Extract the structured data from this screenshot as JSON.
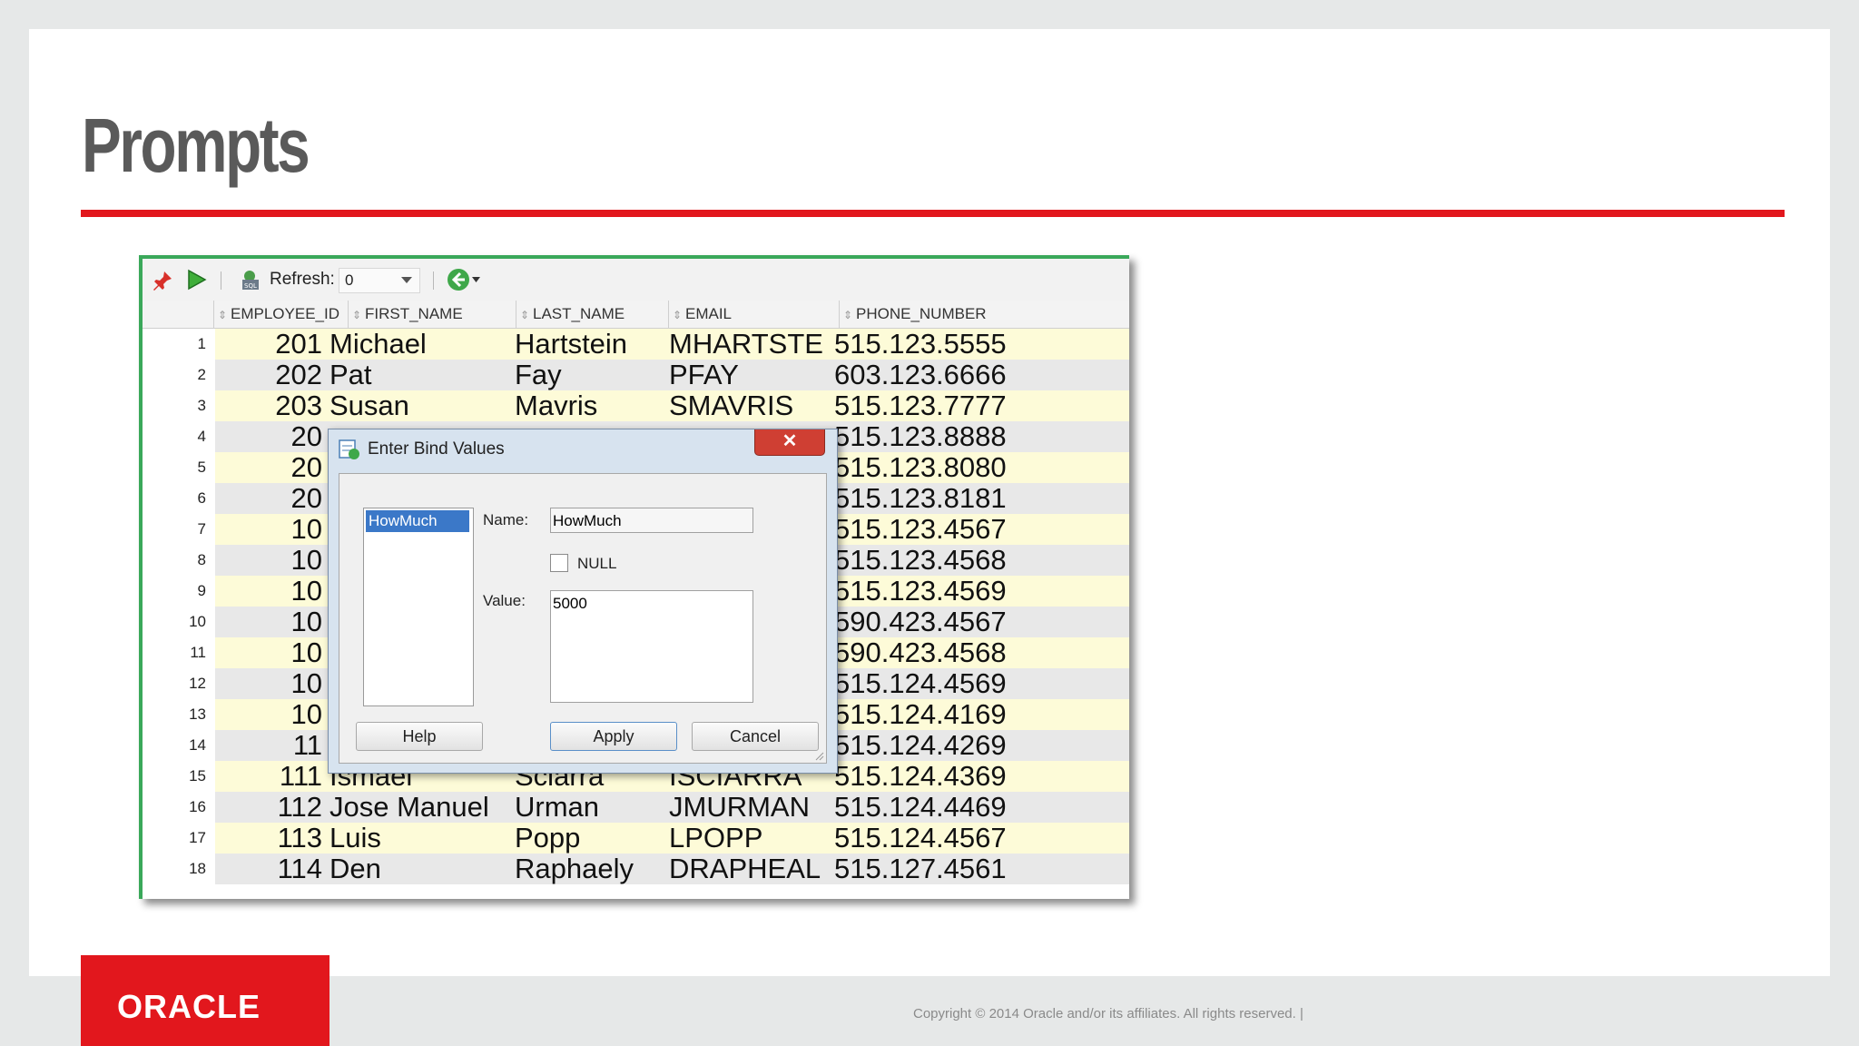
{
  "slide": {
    "title": "Prompts",
    "footer": "Copyright © 2014 Oracle and/or its affiliates. All rights reserved.  |",
    "logo": "ORACLE"
  },
  "toolbar": {
    "refresh_label": "Refresh:",
    "refresh_value": "0",
    "icons": [
      "pin-icon",
      "run-icon",
      "sql-icon",
      "back-icon"
    ]
  },
  "grid": {
    "columns": [
      "EMPLOYEE_ID",
      "FIRST_NAME",
      "LAST_NAME",
      "EMAIL",
      "PHONE_NUMBER"
    ],
    "rows": [
      {
        "n": "1",
        "id": "201",
        "first": "Michael",
        "last": "Hartstein",
        "email": "MHARTSTE",
        "phone": "515.123.5555"
      },
      {
        "n": "2",
        "id": "202",
        "first": "Pat",
        "last": "Fay",
        "email": "PFAY",
        "phone": "603.123.6666"
      },
      {
        "n": "3",
        "id": "203",
        "first": "Susan",
        "last": "Mavris",
        "email": "SMAVRIS",
        "phone": "515.123.7777"
      },
      {
        "n": "4",
        "id": "20",
        "first": "",
        "last": "",
        "email": "",
        "phone": "515.123.8888"
      },
      {
        "n": "5",
        "id": "20",
        "first": "",
        "last": "",
        "email": "",
        "phone": "515.123.8080"
      },
      {
        "n": "6",
        "id": "20",
        "first": "",
        "last": "",
        "email": "",
        "phone": "515.123.8181"
      },
      {
        "n": "7",
        "id": "10",
        "first": "",
        "last": "",
        "email": "",
        "phone": "515.123.4567"
      },
      {
        "n": "8",
        "id": "10",
        "first": "",
        "last": "",
        "email": "",
        "phone": "515.123.4568"
      },
      {
        "n": "9",
        "id": "10",
        "first": "",
        "last": "",
        "email": "",
        "phone": "515.123.4569"
      },
      {
        "n": "10",
        "id": "10",
        "first": "",
        "last": "",
        "email": "",
        "phone": "590.423.4567"
      },
      {
        "n": "11",
        "id": "10",
        "first": "",
        "last": "",
        "email": "",
        "phone": "590.423.4568"
      },
      {
        "n": "12",
        "id": "10",
        "first": "",
        "last": "",
        "email": "",
        "phone": "515.124.4569"
      },
      {
        "n": "13",
        "id": "10",
        "first": "",
        "last": "",
        "email": "",
        "phone": "515.124.4169"
      },
      {
        "n": "14",
        "id": "11",
        "first": "",
        "last": "",
        "email": "",
        "phone": "515.124.4269"
      },
      {
        "n": "15",
        "id": "111",
        "first": "Ismael",
        "last": "Sciarra",
        "email": "ISCIARRA",
        "phone": "515.124.4369"
      },
      {
        "n": "16",
        "id": "112",
        "first": "Jose Manuel",
        "last": "Urman",
        "email": "JMURMAN",
        "phone": "515.124.4469"
      },
      {
        "n": "17",
        "id": "113",
        "first": "Luis",
        "last": "Popp",
        "email": "LPOPP",
        "phone": "515.124.4567"
      },
      {
        "n": "18",
        "id": "114",
        "first": "Den",
        "last": "Raphaely",
        "email": "DRAPHEAL",
        "phone": "515.127.4561"
      }
    ]
  },
  "dialog": {
    "title": "Enter Bind Values",
    "close_glyph": "✕",
    "bind_item": "HowMuch",
    "name_label": "Name:",
    "name_value": "HowMuch",
    "null_label": "NULL",
    "value_label": "Value:",
    "value_text": "5000",
    "help_label": "Help",
    "apply_label": "Apply",
    "cancel_label": "Cancel"
  }
}
